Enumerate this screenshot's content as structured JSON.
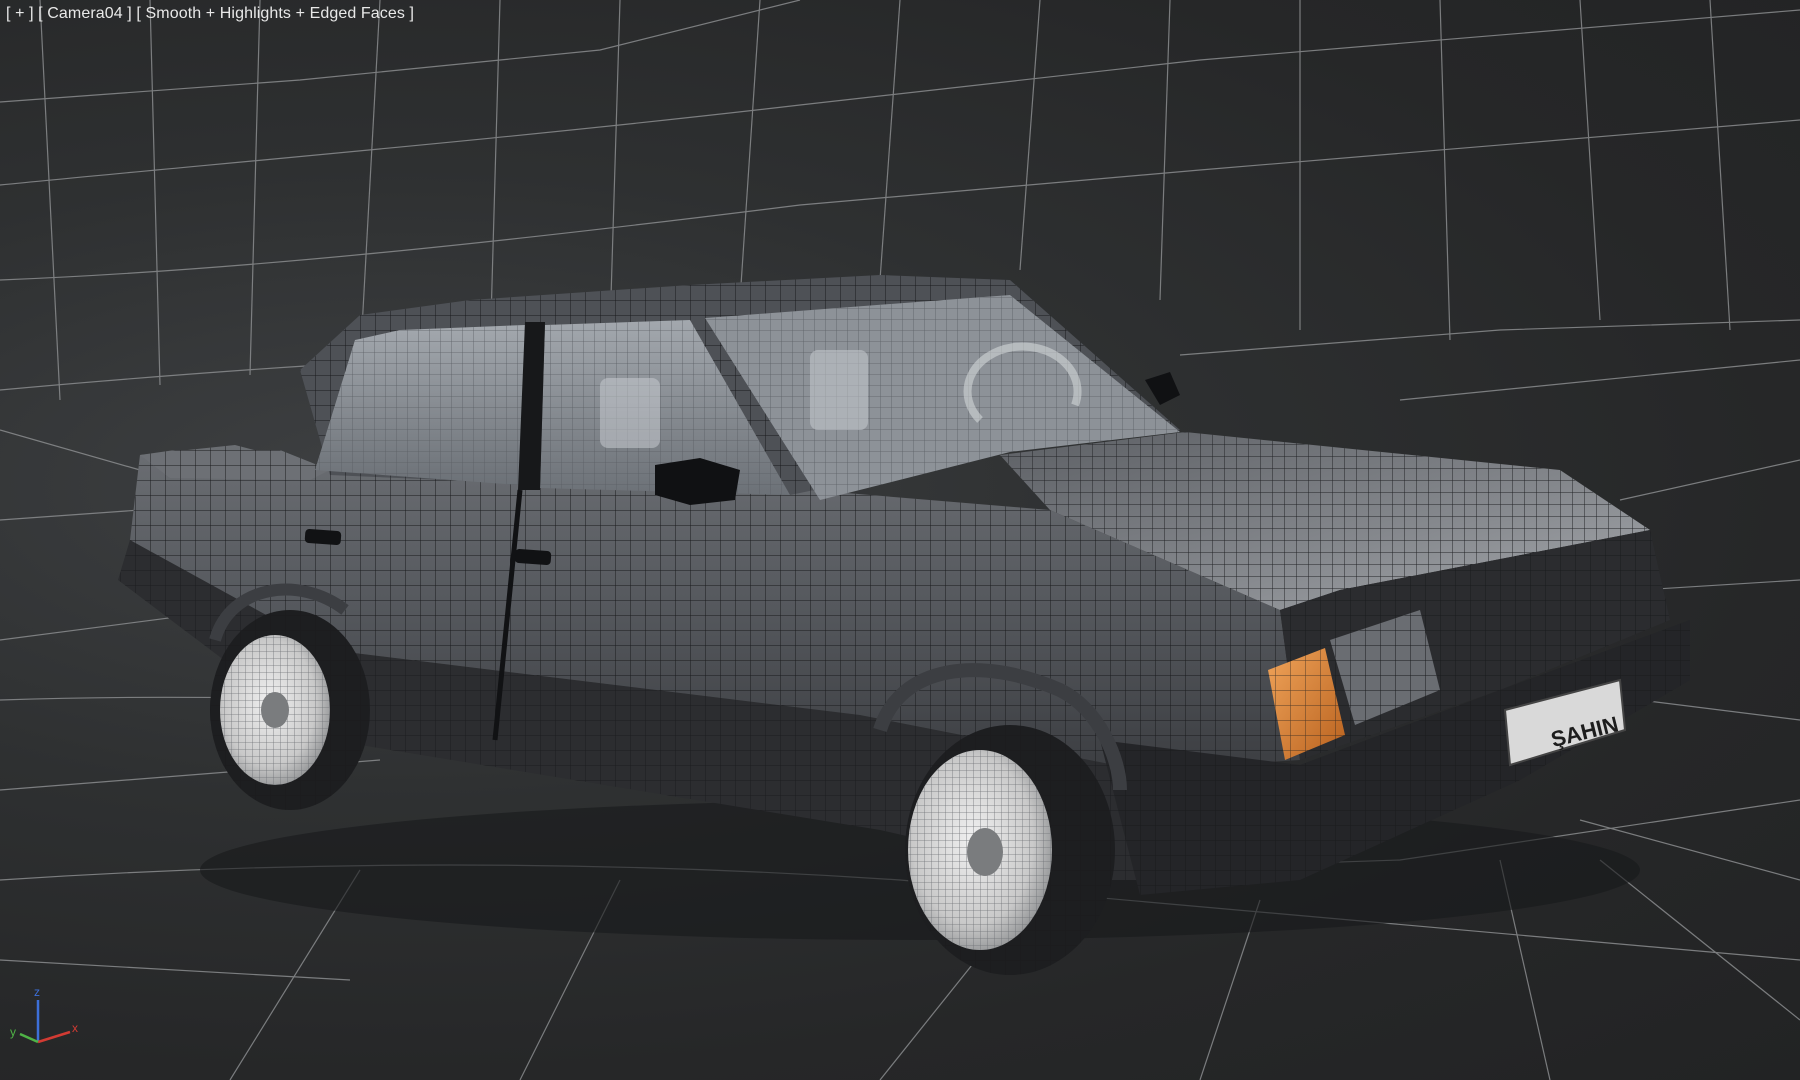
{
  "viewport": {
    "label": {
      "plus_menu": "[ + ]",
      "camera_menu": "[ Camera04 ]",
      "shading_menu": "[ Smooth + Highlights + Edged Faces ]"
    },
    "background_color": "#262728",
    "grid_color": "#8a8c8e"
  },
  "model": {
    "plate_text": "ŞAHIN",
    "body_color": "#5a5c61",
    "turn_signal_color": "#d77d2c"
  },
  "axis_gizmo": {
    "x_label": "x",
    "y_label": "y",
    "z_label": "z",
    "x_color": "#d23b33",
    "y_color": "#4fb346",
    "z_color": "#3d6fd8"
  }
}
